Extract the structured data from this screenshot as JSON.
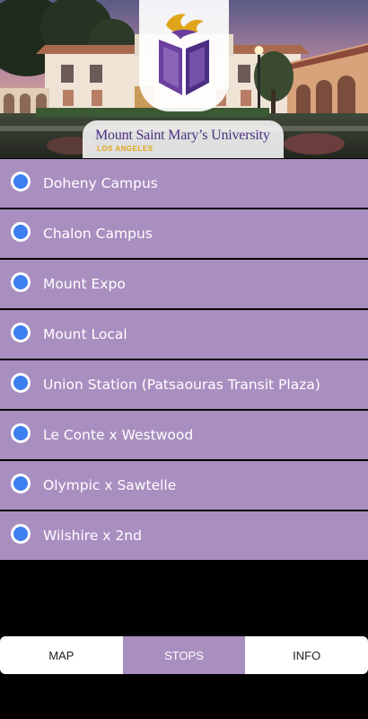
{
  "header": {
    "university_name": "Mount Saint Mary’s University",
    "university_sub": "LOS ANGELES",
    "logo_icon": "open-book-flame-logo",
    "colors": {
      "purple": "#4b2e83",
      "gold": "#e0a51b"
    }
  },
  "stops": {
    "items": [
      {
        "label": "Doheny Campus",
        "icon": "radio-dot-icon"
      },
      {
        "label": "Chalon Campus",
        "icon": "radio-dot-icon"
      },
      {
        "label": "Mount Expo",
        "icon": "radio-dot-icon"
      },
      {
        "label": "Mount Local",
        "icon": "radio-dot-icon"
      },
      {
        "label": "Union Station (Patsaouras Transit Plaza)",
        "icon": "radio-dot-icon"
      },
      {
        "label": "Le Conte x Westwood",
        "icon": "radio-dot-icon"
      },
      {
        "label": "Olympic x Sawtelle",
        "icon": "radio-dot-icon"
      },
      {
        "label": "Wilshire x 2nd",
        "icon": "radio-dot-icon"
      }
    ],
    "colors": {
      "row_bg": "#a98ec0",
      "dot": "#3d7ef0"
    }
  },
  "tabs": {
    "items": [
      {
        "label": "MAP",
        "active": false
      },
      {
        "label": "STOPS",
        "active": true
      },
      {
        "label": "INFO",
        "active": false
      }
    ],
    "colors": {
      "active_bg": "#a98ec0",
      "inactive_bg": "#ffffff"
    }
  }
}
